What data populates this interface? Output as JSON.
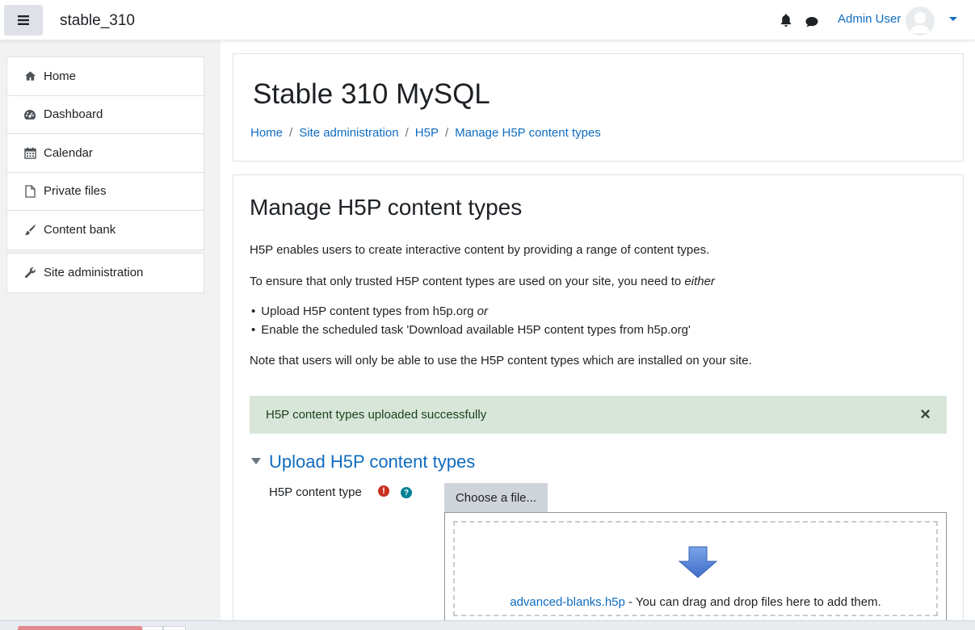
{
  "navbar": {
    "site_name": "stable_310",
    "user_name": "Admin User"
  },
  "sidebar": {
    "items": [
      {
        "label": "Home",
        "icon": "home-icon"
      },
      {
        "label": "Dashboard",
        "icon": "dashboard-icon"
      },
      {
        "label": "Calendar",
        "icon": "calendar-icon"
      },
      {
        "label": "Private files",
        "icon": "file-icon"
      },
      {
        "label": "Content bank",
        "icon": "brush-icon"
      }
    ],
    "admin_item": {
      "label": "Site administration",
      "icon": "wrench-icon"
    }
  },
  "header": {
    "title": "Stable 310 MySQL",
    "breadcrumb": [
      "Home",
      "Site administration",
      "H5P",
      "Manage H5P content types"
    ],
    "separator": "/"
  },
  "content": {
    "title": "Manage H5P content types",
    "intro": "H5P enables users to create interactive content by providing a range of content types.",
    "ensure_prefix": "To ensure that only trusted H5P content types are used on your site, you need to ",
    "ensure_emphasis": "either",
    "bullets": [
      {
        "text": "Upload H5P content types from h5p.org ",
        "emphasis": "or"
      },
      {
        "text": "Enable the scheduled task 'Download available H5P content types from h5p.org'",
        "emphasis": ""
      }
    ],
    "note": "Note that users will only be able to use the H5P content types which are installed on your site.",
    "alert": "H5P content types uploaded successfully",
    "alert_close": "×",
    "section_title": "Upload H5P content types",
    "field_label": "H5P content type",
    "required_mark": "!",
    "help_mark": "?",
    "choose_button": "Choose a file...",
    "file_name": "advanced-blanks.h5p",
    "drop_hint": " - You can drag and drop files here to add them."
  },
  "colors": {
    "link": "#0f6cbf",
    "alert_bg": "#d7e6d8",
    "required": "#ca3120",
    "help": "#008196",
    "drop_arrow": "#5b86d6"
  }
}
